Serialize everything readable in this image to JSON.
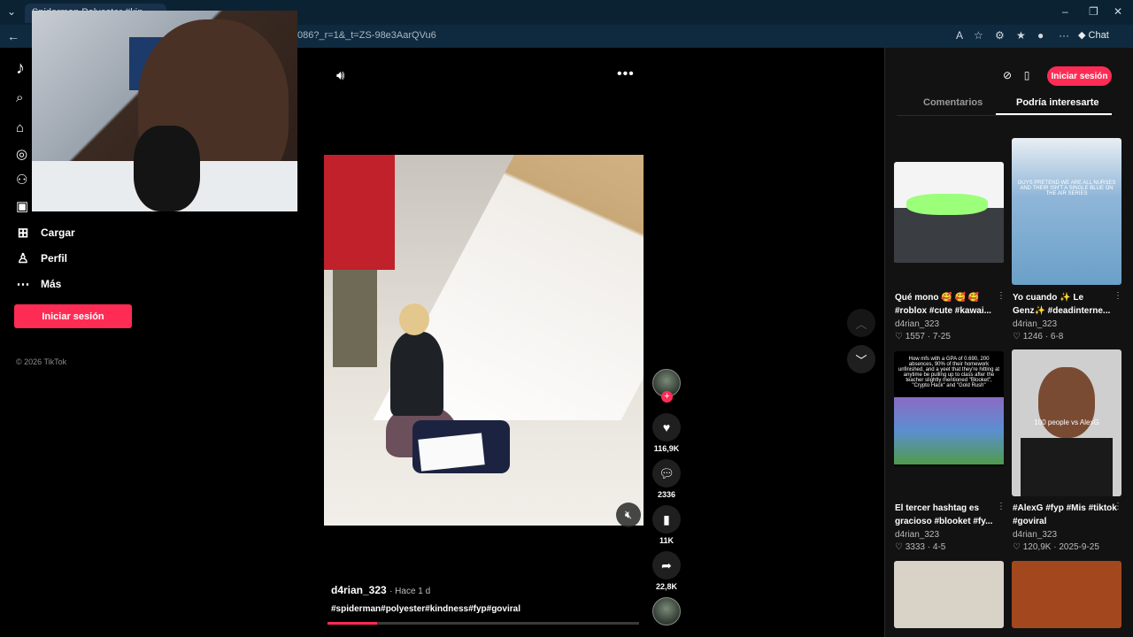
{
  "browser": {
    "tab_title": "Spiderman Polyester #kin",
    "url": "086?_r=1&_t=ZS-98e3AarQVu6",
    "chat_label": "Chat",
    "back_icon": "back-arrow-icon"
  },
  "sidebar": {
    "logo": "♪",
    "items": [
      {
        "label": "Cargar",
        "icon": "upload-icon"
      },
      {
        "label": "Perfil",
        "icon": "profile-icon"
      },
      {
        "label": "Más",
        "icon": "more-icon"
      }
    ],
    "login_label": "Iniciar sesión",
    "copyright": "© 2026 TikTok"
  },
  "video": {
    "author": "d4rian_323",
    "time_ago": "· Hace 1 d",
    "hashtags": "#spiderman#polyester#kindness#fyp#goviral",
    "progress": 0.16,
    "likes": "116,9K",
    "comments": "2336",
    "saves": "11K",
    "shares": "22,8K"
  },
  "right_panel": {
    "login_label": "Iniciar sesión",
    "tabs": [
      "Comentarios",
      "Podría interesarte"
    ],
    "active_tab": 1,
    "cards": [
      {
        "title": "Qué mono 🥰 🥰 🥰 #roblox #cute #kawai...",
        "author": "d4rian_323",
        "likes": "♡ 1557 · 7-25"
      },
      {
        "title": "Yo cuando ✨ Le Genz✨ #deadinterne...",
        "author": "d4rian_323",
        "likes": "♡ 1246 · 6-8",
        "overlay": "GUYS PRETEND WE ARE ALL NURSES AND THEIR ISN'T A SINGLE BLUE ON THE AIR SERIES"
      },
      {
        "title": "El tercer hashtag es gracioso #blooket #fy...",
        "author": "d4rian_323",
        "likes": "♡ 3333 · 4-5",
        "overlay": "How mfs with a GPA of 0.690, 200 absences, 90% of their homework unfinished, and a yeet that they're hitting at anytime be pulling up to class after the teacher slightly mentioned \"Blooket\", \"Crypto Hack\" and \"Gold Rush\""
      },
      {
        "title": "#AlexG #fyp #Mis #tiktok #goviral",
        "author": "d4rian_323",
        "likes": "♡ 120,9K · 2025-9-25",
        "overlay": "100 people vs AlexG"
      }
    ]
  }
}
